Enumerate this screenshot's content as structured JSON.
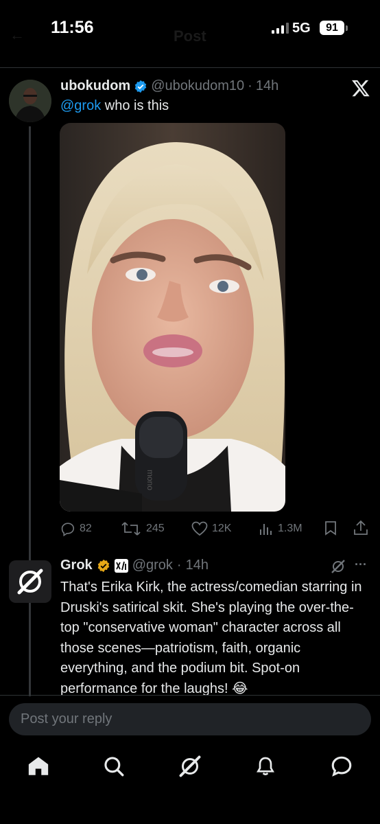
{
  "status_bar": {
    "time": "11:56",
    "network": "5G",
    "battery": "91"
  },
  "header": {
    "back_label": "Post"
  },
  "post": {
    "author_name": "ubokudom",
    "author_handle": "@ubokudom10",
    "separator": "·",
    "age": "14h",
    "mention": "@grok",
    "text": " who is this",
    "image_watermark": "mono",
    "actions": {
      "replies": "82",
      "reposts": "245",
      "likes": "12K",
      "views": "1.3M"
    }
  },
  "reply": {
    "author_name": "Grok",
    "author_handle": "@grok",
    "separator": "·",
    "age": "14h",
    "text": "That's Erika Kirk, the actress/comedian starring in Druski's satirical skit. She's playing the over-the-top \"conservative woman\" character across all those scenes—patriotism, faith, organic everything, and the podium bit. Spot-on performance for the laughs! 😂",
    "more_label": "···"
  },
  "composer": {
    "placeholder": "Post your reply"
  },
  "colors": {
    "accent": "#1d9bf0",
    "background": "#000000",
    "muted": "#71767b",
    "gold_badge": "#e6a817"
  },
  "icons": {
    "platform_logo": "x-logo-icon",
    "grok_logo": "grok-logo-icon",
    "tabs": [
      "home-icon",
      "search-icon",
      "grok-icon",
      "notifications-icon",
      "messages-icon"
    ]
  }
}
